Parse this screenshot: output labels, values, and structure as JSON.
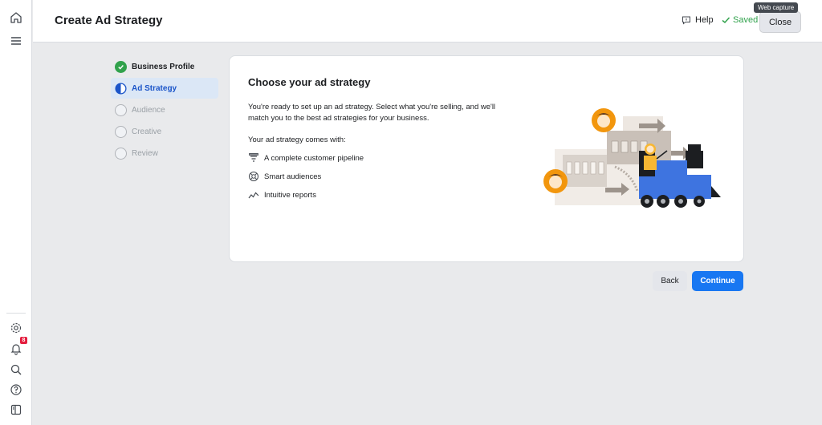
{
  "header": {
    "title": "Create Ad Strategy",
    "help_label": "Help",
    "saved_label": "Saved",
    "close_label": "Close",
    "tooltip": "Web capture"
  },
  "left_rail": {
    "icons": [
      "home-icon",
      "menu-icon",
      "settings-icon",
      "notifications-icon",
      "search-icon",
      "help-icon",
      "panel-toggle-icon"
    ],
    "notification_count": "8"
  },
  "steps": [
    {
      "label": "Business Profile",
      "state": "done"
    },
    {
      "label": "Ad Strategy",
      "state": "active"
    },
    {
      "label": "Audience",
      "state": "pending"
    },
    {
      "label": "Creative",
      "state": "pending"
    },
    {
      "label": "Review",
      "state": "pending"
    }
  ],
  "card": {
    "title": "Choose your ad strategy",
    "description": "You're ready to set up an ad strategy. Select what you're selling, and we'll match you to the best ad strategies for your business.",
    "subtitle": "Your ad strategy comes with:",
    "features": [
      {
        "label": "A complete customer pipeline",
        "icon": "funnel-icon"
      },
      {
        "label": "Smart audiences",
        "icon": "audience-icon"
      },
      {
        "label": "Intuitive reports",
        "icon": "report-icon"
      }
    ]
  },
  "footer": {
    "back_label": "Back",
    "continue_label": "Continue"
  },
  "colors": {
    "accent": "#1877f2",
    "done": "#31a24c",
    "active_bg": "#dbe7f6",
    "active_text": "#1b55c9",
    "badge": "#e41e3f"
  }
}
